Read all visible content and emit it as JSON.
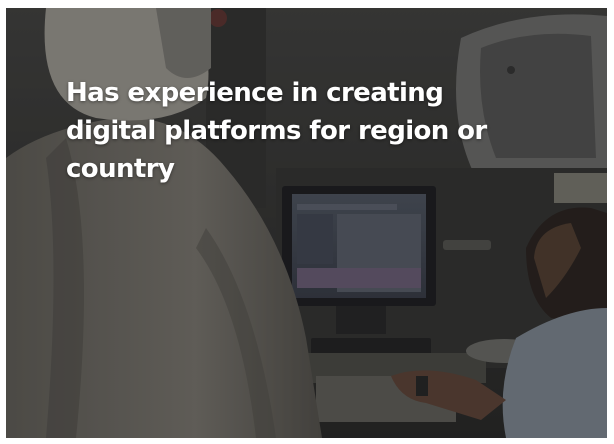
{
  "caption": {
    "text": "Has experience in creating digital platforms for region or country"
  },
  "photo": {
    "overlay_color": "#0f0f0f"
  }
}
